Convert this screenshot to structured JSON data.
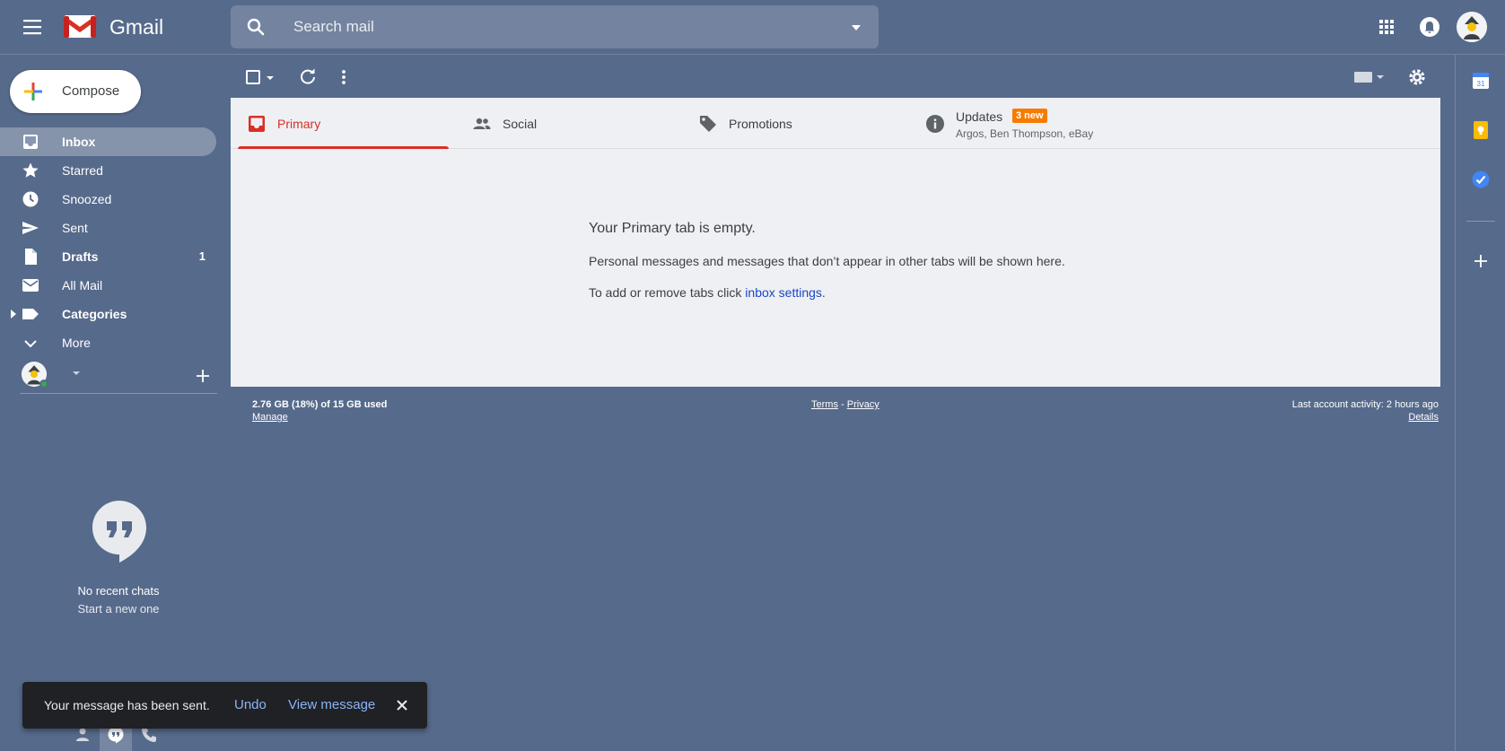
{
  "header": {
    "brand": "Gmail",
    "search_placeholder": "Search mail"
  },
  "sidebar": {
    "compose_label": "Compose",
    "items": [
      {
        "label": "Inbox",
        "count": ""
      },
      {
        "label": "Starred",
        "count": ""
      },
      {
        "label": "Snoozed",
        "count": ""
      },
      {
        "label": "Sent",
        "count": ""
      },
      {
        "label": "Drafts",
        "count": "1"
      },
      {
        "label": "All Mail",
        "count": ""
      },
      {
        "label": "Categories",
        "count": ""
      },
      {
        "label": "More",
        "count": ""
      }
    ]
  },
  "tabs": [
    {
      "label": "Primary",
      "sub": "",
      "badge": ""
    },
    {
      "label": "Social",
      "sub": "",
      "badge": ""
    },
    {
      "label": "Promotions",
      "sub": "",
      "badge": ""
    },
    {
      "label": "Updates",
      "sub": "Argos, Ben Thompson, eBay",
      "badge": "3 new"
    }
  ],
  "empty_state": {
    "title": "Your Primary tab is empty.",
    "line1": "Personal messages and messages that don’t appear in other tabs will be shown here.",
    "line2_prefix": "To add or remove tabs click ",
    "line2_link": "inbox settings",
    "line2_suffix": "."
  },
  "footer": {
    "storage": "2.76 GB (18%) of 15 GB used",
    "manage": "Manage",
    "terms": "Terms",
    "separator": "-",
    "privacy": "Privacy",
    "activity": "Last account activity: 2 hours ago",
    "details": "Details"
  },
  "hangouts": {
    "no_chats": "No recent chats",
    "start_new": "Start a new one"
  },
  "side_panel": {
    "calendar_day": "31"
  },
  "snackbar": {
    "message": "Your message has been sent.",
    "undo": "Undo",
    "view": "View message"
  },
  "colors": {
    "theme_background": "#566a8b",
    "accent_red": "#d93025",
    "badge_orange": "#f57c00",
    "link_blue": "#1a47c4"
  }
}
